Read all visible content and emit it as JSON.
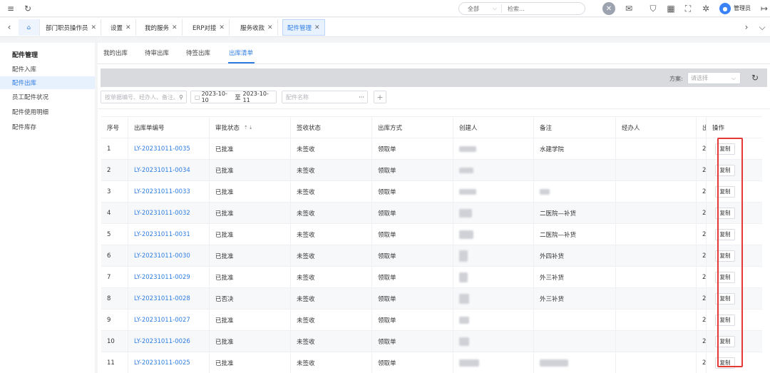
{
  "topbar": {
    "search_scope": "全部",
    "search_placeholder": "检索...",
    "avatar_letter": "",
    "username": "管理员",
    "icons": [
      "menu-icon",
      "refresh-icon",
      "chevron-down-icon",
      "tools-icon",
      "mail-icon",
      "shield-icon",
      "grid-icon",
      "fullscreen-icon",
      "gear-icon",
      "user-icon",
      "logout-icon"
    ]
  },
  "tabs": [
    {
      "label": "部门职员操作员",
      "closable": true
    },
    {
      "label": "设置",
      "closable": true
    },
    {
      "label": "我的服务",
      "closable": true
    },
    {
      "label": "ERP对接",
      "closable": true
    },
    {
      "label": "服务收款",
      "closable": true
    },
    {
      "label": "配件管理",
      "closable": true,
      "active": true
    }
  ],
  "sidebar": {
    "title": "配件管理",
    "items": [
      {
        "label": "配件入库"
      },
      {
        "label": "配件出库",
        "active": true
      },
      {
        "label": "员工配件状况"
      },
      {
        "label": "配件使用明细"
      },
      {
        "label": "配件库存"
      }
    ]
  },
  "subtabs": [
    {
      "label": "我的出库"
    },
    {
      "label": "待审出库"
    },
    {
      "label": "待签出库"
    },
    {
      "label": "出库清单",
      "active": true
    }
  ],
  "filters": {
    "plan_label": "方案:",
    "plan_placeholder": "请选择",
    "keyword_placeholder": "按单据编号、经办人、备注、",
    "date_start": "2023-10-10",
    "date_sep": "至",
    "date_end": "2023-10-11",
    "part_placeholder": "配件名称",
    "more": "···",
    "plus": "+"
  },
  "table": {
    "headers": [
      "序号",
      "出库单编号",
      "审批状态",
      "签收状态",
      "出库方式",
      "创建人",
      "备注",
      "经办人",
      "出",
      "操作"
    ],
    "rows": [
      {
        "no": "1",
        "code": "LY-20231011-0035",
        "approval": "已批准",
        "sign": "未签收",
        "method": "领取单",
        "remark": "水建学院",
        "out": "2",
        "action": "复制"
      },
      {
        "no": "2",
        "code": "LY-20231011-0034",
        "approval": "已批准",
        "sign": "未签收",
        "method": "领取单",
        "remark": "",
        "out": "2",
        "action": "复制"
      },
      {
        "no": "3",
        "code": "LY-20231011-0033",
        "approval": "已批准",
        "sign": "未签收",
        "method": "领取单",
        "remark": "",
        "out": "2",
        "action": "复制"
      },
      {
        "no": "4",
        "code": "LY-20231011-0032",
        "approval": "已批准",
        "sign": "未签收",
        "method": "领取单",
        "remark": "二医院—补货",
        "out": "2",
        "action": "复制"
      },
      {
        "no": "5",
        "code": "LY-20231011-0031",
        "approval": "已批准",
        "sign": "未签收",
        "method": "领取单",
        "remark": "二医院—补货",
        "out": "2",
        "action": "复制"
      },
      {
        "no": "6",
        "code": "LY-20231011-0030",
        "approval": "已批准",
        "sign": "未签收",
        "method": "领取单",
        "remark": "外四补货",
        "out": "2",
        "action": "复制"
      },
      {
        "no": "7",
        "code": "LY-20231011-0029",
        "approval": "已批准",
        "sign": "未签收",
        "method": "领取单",
        "remark": "外三补货",
        "out": "2",
        "action": "复制"
      },
      {
        "no": "8",
        "code": "LY-20231011-0028",
        "approval": "已否决",
        "sign": "未签收",
        "method": "领取单",
        "remark": "外三补货",
        "out": "2",
        "action": "复制"
      },
      {
        "no": "9",
        "code": "LY-20231011-0027",
        "approval": "已批准",
        "sign": "未签收",
        "method": "领取单",
        "remark": "",
        "out": "2",
        "action": "复制"
      },
      {
        "no": "10",
        "code": "LY-20231011-0026",
        "approval": "已批准",
        "sign": "未签收",
        "method": "领取单",
        "remark": "",
        "out": "2",
        "action": "复制"
      },
      {
        "no": "11",
        "code": "LY-20231011-0025",
        "approval": "已批准",
        "sign": "未签收",
        "method": "领取单",
        "remark": "",
        "out": "2",
        "action": "复制"
      }
    ]
  },
  "colors": {
    "accent": "#2f7de1",
    "highlight": "#e53935"
  }
}
